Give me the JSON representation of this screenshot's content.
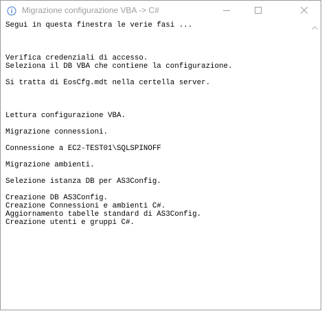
{
  "window": {
    "title": "Migrazione configurazione VBA -> C#",
    "icon": "info-icon",
    "controls": {
      "minimize": "minimize-icon",
      "maximize": "maximize-icon",
      "close": "close-icon"
    },
    "title_color": "#9d9d9d"
  },
  "console": {
    "lines": [
      "Segui in questa finestra le verie fasi ...",
      "",
      "",
      "",
      "Verifica credenziali di accesso.",
      "Seleziona il DB VBA che contiene la configurazione.",
      "",
      "Si tratta di EosCfg.mdt nella certella server.",
      "",
      "",
      "",
      "Lettura configurazione VBA.",
      "",
      "Migrazione connessioni.",
      "",
      "Connessione a EC2-TEST01\\SQLSPINOFF",
      "",
      "Migrazione ambienti.",
      "",
      "Selezione istanza DB per AS3Config.",
      "",
      "Creazione DB AS3Config.",
      "Creazione Connessioni e ambienti C#.",
      "Aggiornamento tabelle standard di AS3Config.",
      "Creazione utenti e gruppi C#."
    ]
  },
  "scrollbar": {
    "up_arrow": "chevron-up-icon"
  }
}
